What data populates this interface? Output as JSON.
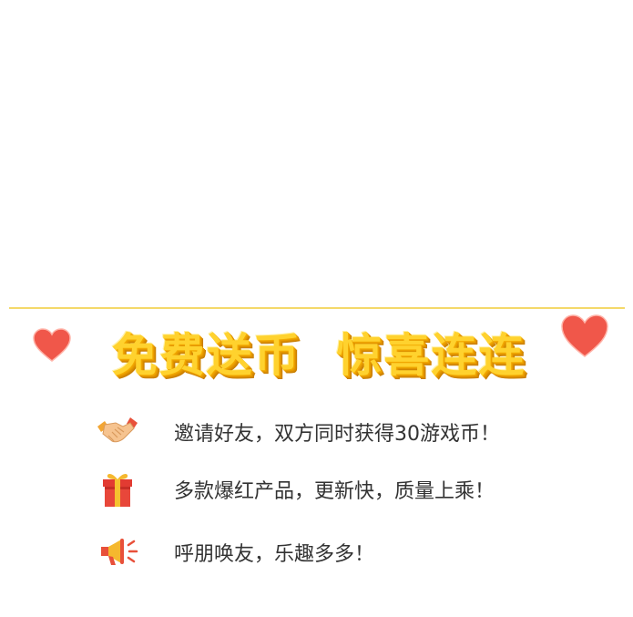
{
  "banner": {
    "title": "免费送币  惊喜连连"
  },
  "features": [
    {
      "icon": "handshake-icon",
      "text": "邀请好友，双方同时获得30游戏币！"
    },
    {
      "icon": "gift-icon",
      "text": "多款爆红产品，更新快，质量上乘！"
    },
    {
      "icon": "megaphone-icon",
      "text": "呼朋唤友，乐趣多多！"
    }
  ],
  "colors": {
    "divider": "#f4d96a",
    "title_fill": "#ffd22e",
    "title_shadow": "#e79a00",
    "heart": "#f0574a",
    "text": "#333333"
  }
}
